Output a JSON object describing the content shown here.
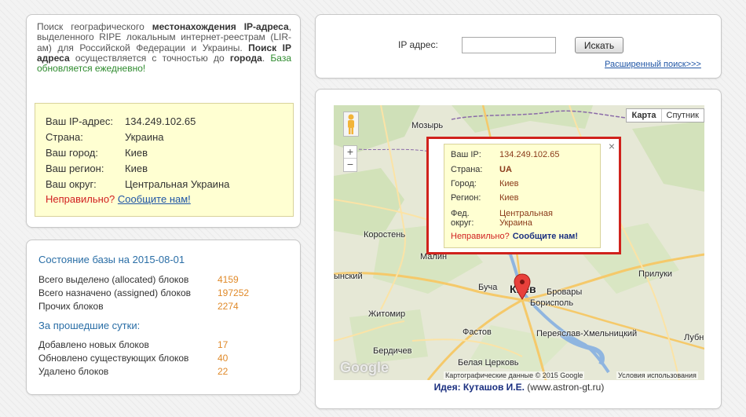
{
  "intro": {
    "p1": "Поиск географического ",
    "b1": "местонахождения IP-адреса",
    "p2": ", выделенного RIPE локальным интернет-реестрам (LIR-ам) для Российской Федерации и Украины. ",
    "b2": "Поиск IP адреса",
    "p3": " осуществляется с точностью до ",
    "b3": "города",
    "p4": ". ",
    "green": "База обновляется ежедневно!"
  },
  "ip_info": {
    "rows": [
      {
        "label": "Ваш IP-адрес:",
        "value": "134.249.102.65"
      },
      {
        "label": "Страна:",
        "value": "Украина"
      },
      {
        "label": "Ваш город:",
        "value": "Киев"
      },
      {
        "label": "Ваш регион:",
        "value": "Киев"
      },
      {
        "label": "Ваш округ:",
        "value": "Центральная Украина"
      }
    ],
    "wrong": "Неправильно?",
    "report": "Сообщите нам!"
  },
  "stats": {
    "state_title": "Состояние базы на 2015-08-01",
    "totals": [
      {
        "label": "Всего выделено (allocated) блоков",
        "value": "4159"
      },
      {
        "label": "Всего назначено (assigned) блоков",
        "value": "197252"
      },
      {
        "label": "Прочих блоков",
        "value": "2274"
      }
    ],
    "past_title": "За прошедшие сутки:",
    "past": [
      {
        "label": "Добавлено новых блоков",
        "value": "17"
      },
      {
        "label": "Обновлено существующих блоков",
        "value": "40"
      },
      {
        "label": "Удалено блоков",
        "value": "22"
      }
    ]
  },
  "search": {
    "label": "IP адрес:",
    "value": "",
    "button": "Искать",
    "advanced": "Расширенный поиск>>>"
  },
  "map": {
    "type_map": "Карта",
    "type_sat": "Спутник",
    "zoom_in": "+",
    "zoom_out": "−",
    "logo": "Google",
    "copyright": "Картографические данные © 2015 Google",
    "terms": "Условия использования",
    "cities": {
      "mozyr": "Мозырь",
      "korosten": "Коростень",
      "malin": "Малин",
      "ynsky": "ынский",
      "bucha": "Буча",
      "kiev": "Киев",
      "brovary": "Бровары",
      "boryspil": "Борисполь",
      "zhitomir": "Житомир",
      "fastov": "Фастов",
      "pereyaslav": "Переяслав-Хмельницкий",
      "berdichev": "Бердичев",
      "belaya": "Белая Церковь",
      "priluki": "Прилуки",
      "lubny": "Лубн"
    },
    "popup": {
      "rows": [
        {
          "label": "Ваш IP:",
          "value": "134.249.102.65"
        },
        {
          "label": "Страна:",
          "value": "UA"
        },
        {
          "label": "Город:",
          "value": "Киев"
        },
        {
          "label": "Регион:",
          "value": "Киев"
        }
      ],
      "okrug_label1": "Фед.",
      "okrug_label2": "округ:",
      "okrug_value1": "Центральная",
      "okrug_value2": "Украина",
      "wrong": "Неправильно?",
      "report": "Сообщите нам!",
      "close": "×"
    }
  },
  "credit": {
    "idea": "Идея: Куташов И.Е.",
    "site": " (www.astron-gt.ru)"
  }
}
